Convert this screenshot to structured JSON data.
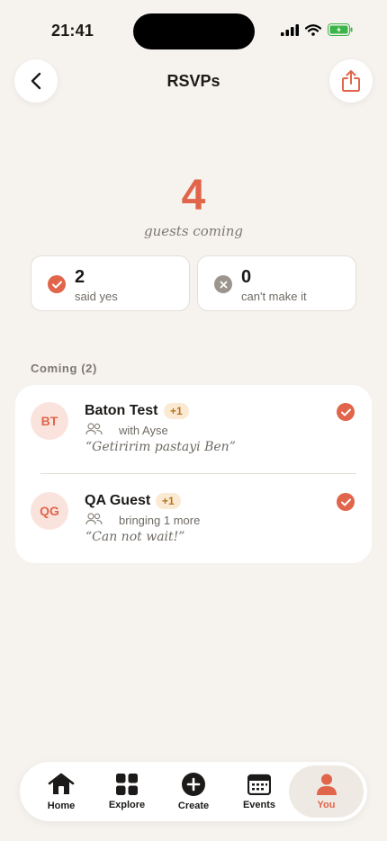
{
  "status_bar": {
    "time": "21:41"
  },
  "header": {
    "title": "RSVPs",
    "back_icon": "chevron-left-icon",
    "share_icon": "share-icon"
  },
  "summary": {
    "count": "4",
    "caption": "guests coming",
    "stats": [
      {
        "value": "2",
        "label": "said yes",
        "icon": "check-circle-icon",
        "color": "#e0654a"
      },
      {
        "value": "0",
        "label": "can't make it",
        "icon": "x-circle-icon",
        "color": "#9c958d"
      }
    ]
  },
  "section": {
    "title": "Coming (2)"
  },
  "guests": [
    {
      "initials": "BT",
      "name": "Baton Test",
      "badge": "+1",
      "meta": "with Ayse",
      "note": "“Getiririm pastayi Ben”"
    },
    {
      "initials": "QG",
      "name": "QA Guest",
      "badge": "+1",
      "meta": "bringing 1 more",
      "note": "“Can not wait!”"
    }
  ],
  "nav": {
    "items": [
      {
        "label": "Home",
        "icon": "home-icon"
      },
      {
        "label": "Explore",
        "icon": "grid-icon"
      },
      {
        "label": "Create",
        "icon": "plus-circle-icon"
      },
      {
        "label": "Events",
        "icon": "calendar-icon"
      },
      {
        "label": "You",
        "icon": "person-icon",
        "active": true
      }
    ]
  },
  "colors": {
    "accent": "#e0654a",
    "background": "#f6f3ef",
    "badge": "#fbead3"
  }
}
